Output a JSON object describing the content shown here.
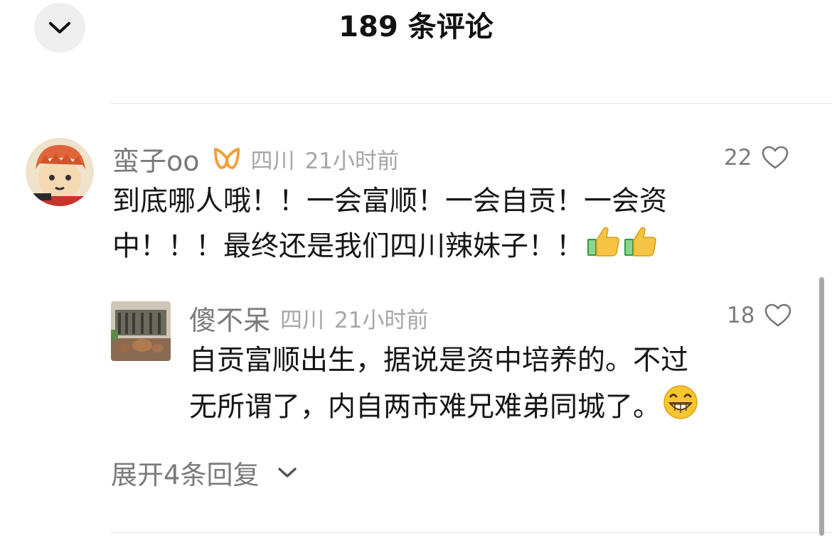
{
  "header": {
    "title": "189 条评论",
    "collapse_icon": "chevron-down-icon"
  },
  "comment": {
    "username": "蛮子oo",
    "badge_icon": "orange-ribbon-badge-icon",
    "location": "四川",
    "time": "21小时前",
    "likes": "22",
    "text_line1": "到底哪人哦！！一会富顺！一会自贡！一会资",
    "text_line2": "中！！！最终还是我们四川辣妹子！！",
    "emojis": [
      "thumbs-up-icon",
      "thumbs-up-icon"
    ]
  },
  "reply": {
    "username": "傻不呆",
    "location": "四川",
    "time": "21小时前",
    "likes": "18",
    "text_line1": "自贡富顺出生，据说是资中培养的。不过",
    "text_line2": "无所谓了，内自两市难兄难弟同城了。",
    "emoji": "grinning-face-icon"
  },
  "expand": {
    "label": "展开4条回复",
    "icon": "chevron-down-icon"
  },
  "colors": {
    "background": "#ffffff",
    "primary_text": "#161616",
    "secondary_text": "#7a7a7a",
    "meta_text": "#a6a6a6",
    "badge": "#f0a13a",
    "divider": "#e6e6e6"
  }
}
